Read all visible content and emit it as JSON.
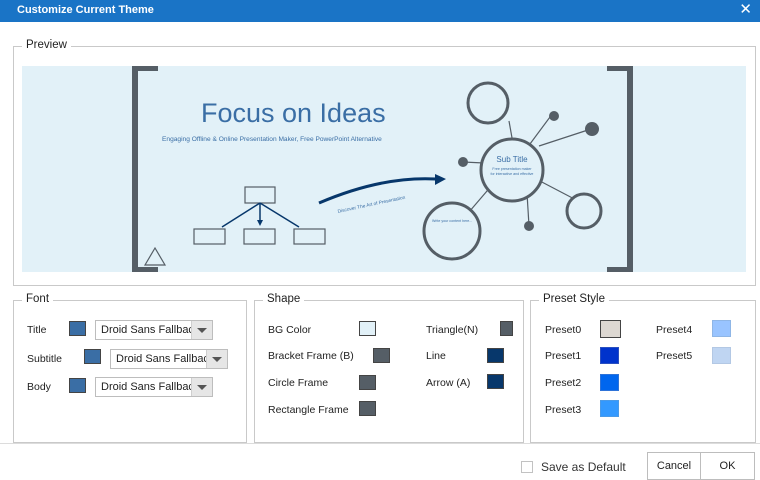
{
  "window": {
    "title": "Customize Current Theme",
    "close_icon": "close-icon"
  },
  "preview": {
    "legend": "Preview",
    "slide": {
      "title": "Focus on Ideas",
      "subtitle": "Engaging Offline & Online Presentation Maker, Free PowerPoint Alternative",
      "arrow_text": "Discover The Art of Presentation",
      "circle_title": "Sub Title",
      "circle_line1": "Free presentation maker",
      "circle_line2": "for interactive and effective",
      "small_circle_text": "Write your content here..."
    }
  },
  "font": {
    "legend": "Font",
    "rows": [
      {
        "label": "Title",
        "color": "#3a6ea5",
        "value": "Droid Sans Fallback"
      },
      {
        "label": "Subtitle",
        "color": "#3a6ea5",
        "value": "Droid Sans Fallback"
      },
      {
        "label": "Body",
        "color": "#3a6ea5",
        "value": "Droid Sans Fallback"
      }
    ]
  },
  "shape": {
    "legend": "Shape",
    "left": [
      {
        "label": "BG Color",
        "color": "#e2f1f8"
      },
      {
        "label": "Bracket Frame (B)",
        "color": "#555e66"
      },
      {
        "label": "Circle Frame",
        "color": "#555e66"
      },
      {
        "label": "Rectangle Frame",
        "color": "#555e66"
      }
    ],
    "right": [
      {
        "label": "Triangle(N)",
        "color": "#555e66"
      },
      {
        "label": "Line",
        "color": "#07376b"
      },
      {
        "label": "Arrow (A)",
        "color": "#07376b"
      }
    ]
  },
  "preset": {
    "legend": "Preset Style",
    "left": [
      {
        "label": "Preset0",
        "color": "#ddd8d2"
      },
      {
        "label": "Preset1",
        "color": "#0033cc"
      },
      {
        "label": "Preset2",
        "color": "#0066ee"
      },
      {
        "label": "Preset3",
        "color": "#3399ff"
      }
    ],
    "right": [
      {
        "label": "Preset4",
        "color": "#99c4ff"
      },
      {
        "label": "Preset5",
        "color": "#bfd5f2"
      }
    ]
  },
  "footer": {
    "save_default": "Save as Default",
    "cancel": "Cancel",
    "ok": "OK"
  }
}
